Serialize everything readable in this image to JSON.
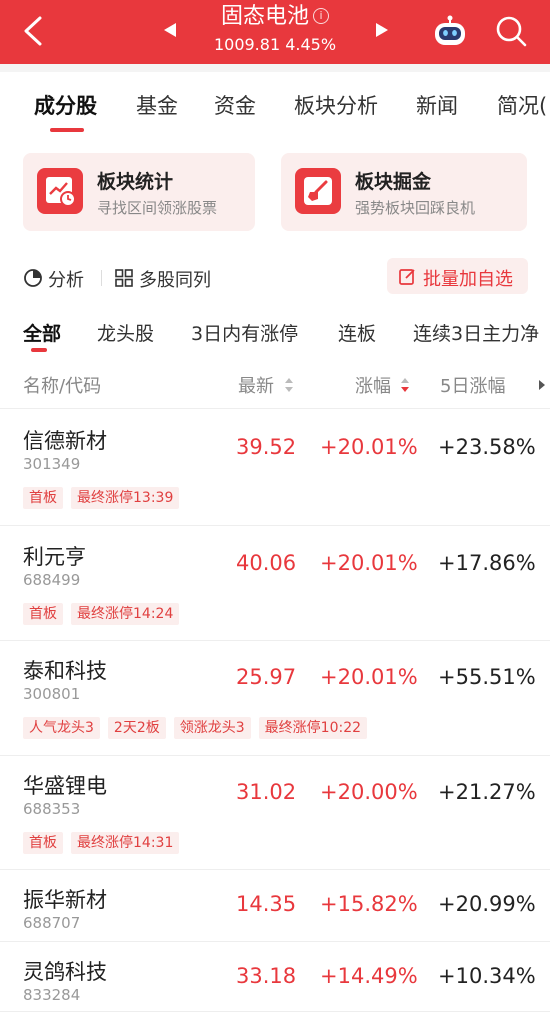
{
  "header": {
    "title": "固态电池",
    "info_glyph": "i",
    "index_value": "1009.81",
    "index_change": "4.45%"
  },
  "tabs": [
    "成分股",
    "基金",
    "资金",
    "板块分析",
    "新闻",
    "简况("
  ],
  "cards": [
    {
      "title": "板块统计",
      "subtitle": "寻找区间领涨股票",
      "icon": "chart-clock-icon"
    },
    {
      "title": "板块掘金",
      "subtitle": "强势板块回踩良机",
      "icon": "shovel-icon"
    }
  ],
  "toolbar": {
    "analyze": "分析",
    "multi": "多股同列",
    "batch_add": "批量加自选"
  },
  "subtabs": [
    "全部",
    "龙头股",
    "3日内有涨停",
    "连板",
    "连续3日主力净"
  ],
  "table_header": {
    "name": "名称/代码",
    "price": "最新",
    "change": "涨幅",
    "change5": "5日涨幅"
  },
  "stocks": [
    {
      "name": "信德新材",
      "code": "301349",
      "price": "39.52",
      "change": "+20.01%",
      "change5": "+23.58%",
      "tags": [
        "首板",
        "最终涨停13:39"
      ]
    },
    {
      "name": "利元亨",
      "code": "688499",
      "price": "40.06",
      "change": "+20.01%",
      "change5": "+17.86%",
      "tags": [
        "首板",
        "最终涨停14:24"
      ]
    },
    {
      "name": "泰和科技",
      "code": "300801",
      "price": "25.97",
      "change": "+20.01%",
      "change5": "+55.51%",
      "tags": [
        "人气龙头3",
        "2天2板",
        "领涨龙头3",
        "最终涨停10:22"
      ]
    },
    {
      "name": "华盛锂电",
      "code": "688353",
      "price": "31.02",
      "change": "+20.00%",
      "change5": "+21.27%",
      "tags": [
        "首板",
        "最终涨停14:31"
      ]
    },
    {
      "name": "振华新材",
      "code": "688707",
      "price": "14.35",
      "change": "+15.82%",
      "change5": "+20.99%",
      "tags": []
    },
    {
      "name": "灵鸽科技",
      "code": "833284",
      "price": "33.18",
      "change": "+14.49%",
      "change5": "+10.34%",
      "tags": []
    }
  ],
  "colors": {
    "accent": "#e8383d",
    "tag_bg": "#fbeeed"
  }
}
